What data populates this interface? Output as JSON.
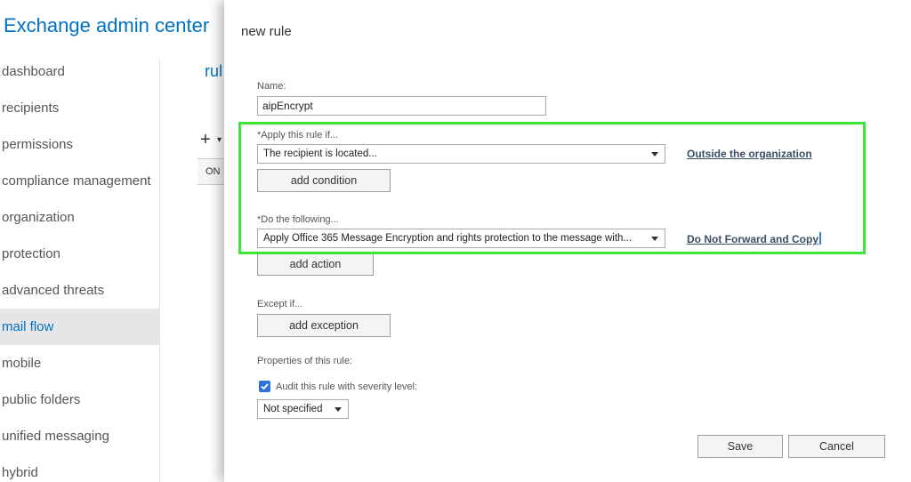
{
  "app": {
    "title": "Exchange admin center"
  },
  "nav": {
    "items": [
      {
        "label": "dashboard"
      },
      {
        "label": "recipients"
      },
      {
        "label": "permissions"
      },
      {
        "label": "compliance management"
      },
      {
        "label": "organization"
      },
      {
        "label": "protection"
      },
      {
        "label": "advanced threats"
      },
      {
        "label": "mail flow"
      },
      {
        "label": "mobile"
      },
      {
        "label": "public folders"
      },
      {
        "label": "unified messaging"
      },
      {
        "label": "hybrid"
      }
    ],
    "active": "mail flow"
  },
  "background": {
    "heading": "rul",
    "add_icon": "+",
    "toggle_label": "ON"
  },
  "dialog": {
    "title": "new rule",
    "name_label": "Name:",
    "name_value": "aipEncrypt",
    "apply_label": "*Apply this rule if...",
    "apply_select": "The recipient is located...",
    "apply_link": "Outside the organization",
    "add_condition": "add condition",
    "do_label": "*Do the following...",
    "do_select": "Apply Office 365 Message Encryption and rights protection to the message with...",
    "do_link": "Do Not Forward and Copy",
    "add_action": "add action",
    "except_label": "Except if...",
    "add_exception": "add exception",
    "properties_label": "Properties of this rule:",
    "audit_label": "Audit this rule with severity level:",
    "audit_checked": true,
    "severity_select": "Not specified",
    "save": "Save",
    "cancel": "Cancel"
  },
  "colors": {
    "accent": "#0072c6",
    "highlight": "#39e639",
    "checkbox": "#2f72d9"
  }
}
